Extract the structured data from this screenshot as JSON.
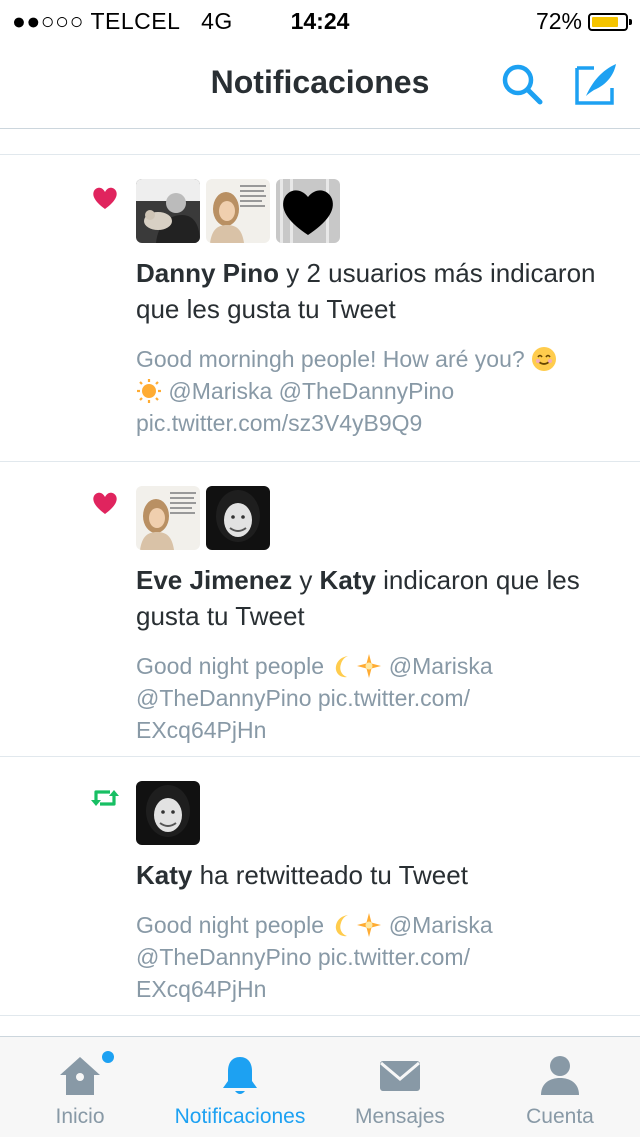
{
  "status_bar": {
    "signal": "●●○○○",
    "carrier": "TELCEL",
    "network": "4G",
    "time": "14:24",
    "battery": "72%",
    "battery_level": 0.72
  },
  "header": {
    "title": "Notificaciones"
  },
  "notifications": [
    {
      "type": "like",
      "text_parts": [
        "Danny Pino",
        " y 2 usuarios más indicaron que les gusta tu Tweet"
      ],
      "tweet_lines": [
        "Good morningh people! How aré you? ",
        " @Mariska @TheDannyPino",
        "pic.twitter.com/sz3V4yB9Q9"
      ]
    },
    {
      "type": "like",
      "text_parts": [
        "Eve Jimenez",
        " y ",
        "Katy",
        " indicaron que les gusta tu Tweet"
      ],
      "tweet_lines": [
        "Good night people ",
        " @Mariska",
        "@TheDannyPino pic.twitter.com/",
        "EXcq64PjHn"
      ]
    },
    {
      "type": "retweet",
      "text_parts": [
        "Katy",
        " ha retwitteado tu Tweet"
      ],
      "tweet_lines": [
        "Good night people ",
        " @Mariska",
        "@TheDannyPino pic.twitter.com/",
        "EXcq64PjHn"
      ]
    }
  ],
  "tab_bar": {
    "tabs": [
      {
        "label": "Inicio",
        "icon": "home-icon"
      },
      {
        "label": "Notificaciones",
        "icon": "bell-icon"
      },
      {
        "label": "Mensajes",
        "icon": "envelope-icon"
      },
      {
        "label": "Cuenta",
        "icon": "person-icon"
      }
    ],
    "active_tab": "Notificaciones"
  },
  "colors": {
    "accent": "#1da1f2",
    "like": "#e0245e",
    "retweet": "#17bf63",
    "secondary_text": "#8899a6"
  }
}
